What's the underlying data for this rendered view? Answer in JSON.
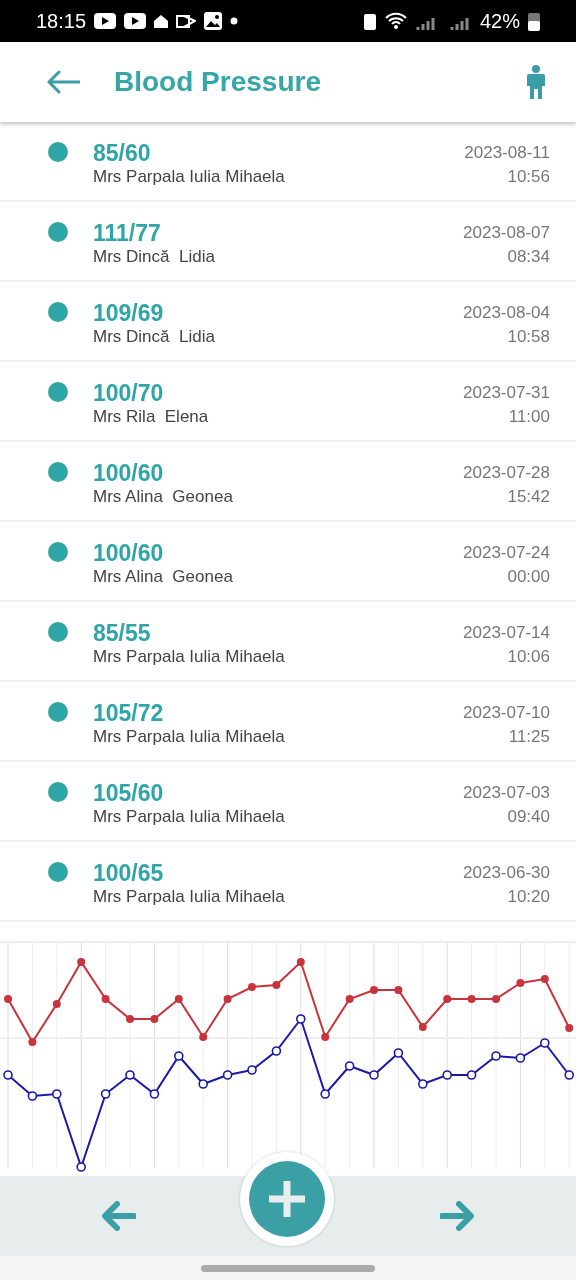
{
  "status_bar": {
    "time": "18:15",
    "battery": "42%"
  },
  "header": {
    "title": "Blood Pressure"
  },
  "readings": [
    {
      "value": "85/60",
      "name": "Mrs Parpala Iulia Mihaela",
      "date": "2023-08-11",
      "time": "10:56"
    },
    {
      "value": "111/77",
      "name": "Mrs Dincă  Lidia",
      "date": "2023-08-07",
      "time": "08:34"
    },
    {
      "value": "109/69",
      "name": "Mrs Dincă  Lidia",
      "date": "2023-08-04",
      "time": "10:58"
    },
    {
      "value": "100/70",
      "name": "Mrs Rila  Elena",
      "date": "2023-07-31",
      "time": "11:00"
    },
    {
      "value": "100/60",
      "name": "Mrs Alina  Geonea",
      "date": "2023-07-28",
      "time": "15:42"
    },
    {
      "value": "100/60",
      "name": "Mrs Alina  Geonea",
      "date": "2023-07-24",
      "time": "00:00"
    },
    {
      "value": "85/55",
      "name": "Mrs Parpala Iulia Mihaela",
      "date": "2023-07-14",
      "time": "10:06"
    },
    {
      "value": "105/72",
      "name": "Mrs Parpala Iulia Mihaela",
      "date": "2023-07-10",
      "time": "11:25"
    },
    {
      "value": "105/60",
      "name": "Mrs Parpala Iulia Mihaela",
      "date": "2023-07-03",
      "time": "09:40"
    },
    {
      "value": "100/65",
      "name": "Mrs Parpala Iulia Mihaela",
      "date": "2023-06-30",
      "time": "10:20"
    }
  ]
}
